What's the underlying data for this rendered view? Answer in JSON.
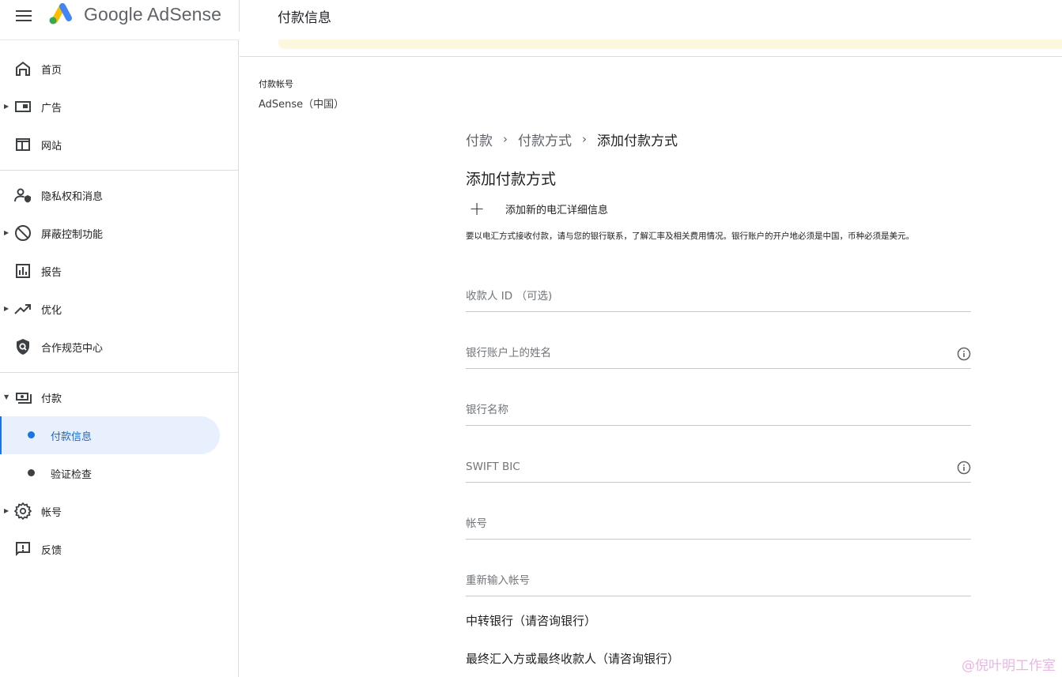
{
  "header": {
    "brand": "Google AdSense",
    "page_title": "付款信息"
  },
  "sidebar": {
    "items": [
      {
        "label": "首页",
        "icon": "home-icon"
      },
      {
        "label": "广告",
        "icon": "ads-icon"
      },
      {
        "label": "网站",
        "icon": "sites-icon"
      },
      {
        "label": "隐私权和消息",
        "icon": "privacy-icon"
      },
      {
        "label": "屏蔽控制功能",
        "icon": "block-icon"
      },
      {
        "label": "报告",
        "icon": "reports-icon"
      },
      {
        "label": "优化",
        "icon": "optimization-icon"
      },
      {
        "label": "合作规范中心",
        "icon": "policy-center-icon"
      },
      {
        "label": "付款",
        "icon": "payments-icon"
      },
      {
        "label": "帐号",
        "icon": "settings-icon"
      },
      {
        "label": "反馈",
        "icon": "feedback-icon"
      }
    ],
    "payments_sub": [
      {
        "label": "付款信息",
        "active": true
      },
      {
        "label": "验证检查",
        "active": false
      }
    ]
  },
  "account": {
    "label": "付款帐号",
    "value": "AdSense（中国）"
  },
  "breadcrumb": [
    "付款",
    "付款方式",
    "添加付款方式"
  ],
  "main": {
    "title": "添加付款方式",
    "add_label": "添加新的电汇详细信息",
    "notice": "要以电汇方式接收付款，请与您的银行联系，了解汇率及相关费用情况。银行账户的开户地必须是中国，币种必须是美元。",
    "fields": [
      {
        "placeholder": "收款人 ID （可选)",
        "value": ""
      },
      {
        "placeholder": "银行账户上的姓名",
        "value": ""
      },
      {
        "placeholder": "银行名称",
        "value": ""
      },
      {
        "placeholder": "SWIFT BIC",
        "value": ""
      },
      {
        "placeholder": "帐号",
        "value": ""
      },
      {
        "placeholder": "重新输入帐号",
        "value": ""
      }
    ],
    "intermediary_bank": "中转银行（请咨询银行）",
    "final_beneficiary": "最终汇入方或最终收款人（请咨询银行）"
  },
  "watermark": "@倪叶明工作室",
  "colors": {
    "accent": "#1a73e8",
    "active_bg": "#e8f0fe",
    "banner": "#fef7e0"
  }
}
